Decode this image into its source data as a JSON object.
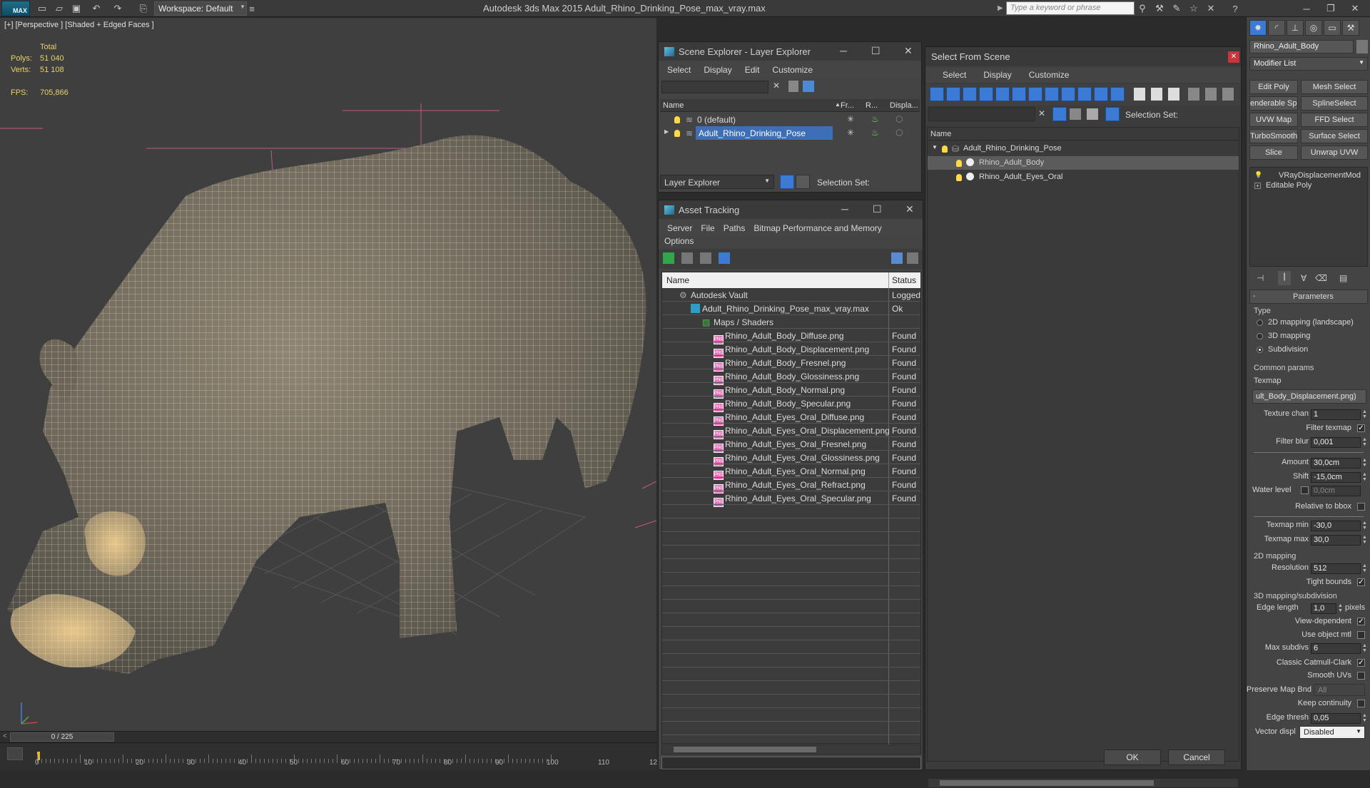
{
  "app": {
    "logo": "MAX",
    "workspace": "Workspace: Default",
    "title": "Autodesk 3ds Max  2015      Adult_Rhino_Drinking_Pose_max_vray.max",
    "search_placeholder": "Type a keyword or phrase"
  },
  "viewport": {
    "label": "[+] [Perspective ] [Shaded + Edged Faces ]",
    "stats_header": "Total",
    "polys_label": "Polys:",
    "polys_value": "51 040",
    "verts_label": "Verts:",
    "verts_value": "51 108",
    "fps_label": "FPS:",
    "fps_value": "705,866"
  },
  "timeline": {
    "frame": "0 / 225",
    "ticks": [
      "0",
      "10",
      "20",
      "30",
      "40",
      "50",
      "60",
      "70",
      "80",
      "90",
      "100",
      "110",
      "12"
    ]
  },
  "scene_explorer": {
    "title": "Scene Explorer - Layer Explorer",
    "menu": [
      "Select",
      "Display",
      "Edit",
      "Customize"
    ],
    "columns": [
      "Name",
      "Fr...",
      "R...",
      "Displa..."
    ],
    "rows": [
      "0 (default)",
      "Adult_Rhino_Drinking_Pose"
    ],
    "footer_dropdown": "Layer Explorer",
    "footer_label": "Selection Set:"
  },
  "asset_tracking": {
    "title": "Asset Tracking",
    "menu": [
      "Server",
      "File",
      "Paths",
      "Bitmap Performance and Memory"
    ],
    "menu2": "Options",
    "columns": [
      "Name",
      "Status"
    ],
    "rows": [
      {
        "name": "Autodesk Vault",
        "status": "Logged"
      },
      {
        "name": "Adult_Rhino_Drinking_Pose_max_vray.max",
        "status": "Ok"
      },
      {
        "name": "Maps / Shaders",
        "status": ""
      },
      {
        "name": "Rhino_Adult_Body_Diffuse.png",
        "status": "Found"
      },
      {
        "name": "Rhino_Adult_Body_Displacement.png",
        "status": "Found"
      },
      {
        "name": "Rhino_Adult_Body_Fresnel.png",
        "status": "Found"
      },
      {
        "name": "Rhino_Adult_Body_Glossiness.png",
        "status": "Found"
      },
      {
        "name": "Rhino_Adult_Body_Normal.png",
        "status": "Found"
      },
      {
        "name": "Rhino_Adult_Body_Specular.png",
        "status": "Found"
      },
      {
        "name": "Rhino_Adult_Eyes_Oral_Diffuse.png",
        "status": "Found"
      },
      {
        "name": "Rhino_Adult_Eyes_Oral_Displacement.png",
        "status": "Found"
      },
      {
        "name": "Rhino_Adult_Eyes_Oral_Fresnel.png",
        "status": "Found"
      },
      {
        "name": "Rhino_Adult_Eyes_Oral_Glossiness.png",
        "status": "Found"
      },
      {
        "name": "Rhino_Adult_Eyes_Oral_Normal.png",
        "status": "Found"
      },
      {
        "name": "Rhino_Adult_Eyes_Oral_Refract.png",
        "status": "Found"
      },
      {
        "name": "Rhino_Adult_Eyes_Oral_Specular.png",
        "status": "Found"
      }
    ]
  },
  "select_from_scene": {
    "title": "Select From Scene",
    "menu": [
      "Select",
      "Display",
      "Customize"
    ],
    "selection_set_label": "Selection Set:",
    "column": "Name",
    "rows": [
      "Adult_Rhino_Drinking_Pose",
      "Rhino_Adult_Body",
      "Rhino_Adult_Eyes_Oral"
    ],
    "ok": "OK",
    "cancel": "Cancel"
  },
  "command_panel": {
    "object_name": "Rhino_Adult_Body",
    "modifier_list": "Modifier List",
    "buttons": [
      "Edit Poly",
      "Mesh Select",
      "enderable Splin",
      "SplineSelect",
      "UVW Map",
      "FFD Select",
      "TurboSmooth",
      "Surface Select",
      "Slice",
      "Unwrap UVW"
    ],
    "stack": [
      "VRayDisplacementMod",
      "Editable Poly"
    ],
    "rollout": "Parameters",
    "type_label": "Type",
    "type_options": [
      "2D mapping (landscape)",
      "3D mapping",
      "Subdivision"
    ],
    "common_params": "Common params",
    "texmap_label": "Texmap",
    "texmap_value": "ult_Body_Displacement.png)",
    "texture_chan_label": "Texture chan",
    "texture_chan_value": "1",
    "filter_texmap": "Filter texmap",
    "filter_blur_label": "Filter blur",
    "filter_blur_value": "0,001",
    "amount_label": "Amount",
    "amount_value": "30,0cm",
    "shift_label": "Shift",
    "shift_value": "-15,0cm",
    "water_level_label": "Water level",
    "water_level_value": "0,0cm",
    "relative_bbox": "Relative to bbox",
    "texmap_min_label": "Texmap min",
    "texmap_min_value": "-30,0",
    "texmap_max_label": "Texmap max",
    "texmap_max_value": "30,0",
    "mapping2d": "2D mapping",
    "resolution_label": "Resolution",
    "resolution_value": "512",
    "tight_bounds": "Tight bounds",
    "mapping3d": "3D mapping/subdivision",
    "edge_length_label": "Edge length",
    "edge_length_value": "1,0",
    "pixels": "pixels",
    "view_dependent": "View-dependent",
    "use_object_mtl": "Use object mtl",
    "max_subdivs_label": "Max subdivs",
    "max_subdivs_value": "6",
    "classic_catmull": "Classic Catmull-Clark",
    "smooth_uvs": "Smooth UVs",
    "preserve_map_label": "Preserve Map Bnd",
    "preserve_map_value": "All",
    "keep_continuity": "Keep continuity",
    "edge_thresh_label": "Edge thresh",
    "edge_thresh_value": "0,05",
    "vector_displ_label": "Vector displ",
    "vector_displ_value": "Disabled"
  }
}
